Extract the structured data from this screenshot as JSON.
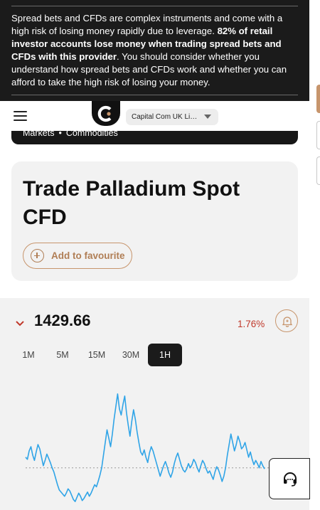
{
  "risk_warning": {
    "part1": "Spread bets and CFDs are complex instruments and come with a high risk of losing money rapidly due to leverage. ",
    "bold": "82% of retail investor accounts lose money when trading spread bets and CFDs with this provider",
    "part2": ". You should consider whether you understand how spread bets and CFDs work and whether you can afford to take the high risk of losing your money."
  },
  "header": {
    "entity_selected": "Capital Com UK Limited"
  },
  "breadcrumb": {
    "items": [
      "Markets",
      "Commodities"
    ],
    "separator": "•"
  },
  "instrument": {
    "title": "Trade Palladium Spot CFD",
    "favourite_label": "Add to favourite"
  },
  "quote": {
    "price": "1429.66",
    "change": "1.76%",
    "direction": "down",
    "down_color": "#c0392b"
  },
  "timeframes": [
    {
      "label": "1M",
      "active": false
    },
    {
      "label": "5M",
      "active": false
    },
    {
      "label": "15M",
      "active": false
    },
    {
      "label": "30M",
      "active": false
    },
    {
      "label": "1H",
      "active": true
    }
  ],
  "colors": {
    "accent": "#c7956c",
    "line": "#2fa4e7",
    "dark": "#1b1b1b"
  },
  "icons": {
    "menu": "hamburger-icon",
    "logo": "capital-com-logo",
    "favourite": "plus-circle-icon",
    "direction": "chevron-down-icon",
    "alert": "bell-plus-icon",
    "support": "headset-icon"
  },
  "chart_data": {
    "type": "line",
    "values": [
      50,
      48,
      56,
      60,
      52,
      47,
      55,
      62,
      58,
      50,
      42,
      47,
      53,
      49,
      45,
      40,
      36,
      30,
      24,
      19,
      17,
      15,
      13,
      16,
      20,
      18,
      14,
      10,
      8,
      12,
      16,
      13,
      9,
      11,
      14,
      17,
      13,
      16,
      20,
      24,
      22,
      27,
      33,
      40,
      52,
      64,
      76,
      68,
      60,
      72,
      86,
      98,
      110,
      96,
      90,
      100,
      108,
      92,
      80,
      70,
      84,
      95,
      86,
      74,
      64,
      55,
      52,
      57,
      50,
      45,
      54,
      60,
      56,
      50,
      44,
      38,
      32,
      37,
      42,
      46,
      41,
      35,
      31,
      36,
      44,
      50,
      54,
      48,
      42,
      38,
      36,
      39,
      44,
      40,
      43,
      48,
      45,
      40,
      36,
      42,
      47,
      44,
      39,
      35,
      37,
      33,
      29,
      36,
      41,
      38,
      33,
      27,
      32,
      40,
      52,
      62,
      72,
      64,
      56,
      62,
      70,
      65,
      58,
      60,
      64,
      57,
      50,
      55,
      48,
      43,
      47,
      44,
      40,
      46,
      42,
      39
    ],
    "baseline": 40,
    "ylim": [
      0,
      120
    ]
  }
}
